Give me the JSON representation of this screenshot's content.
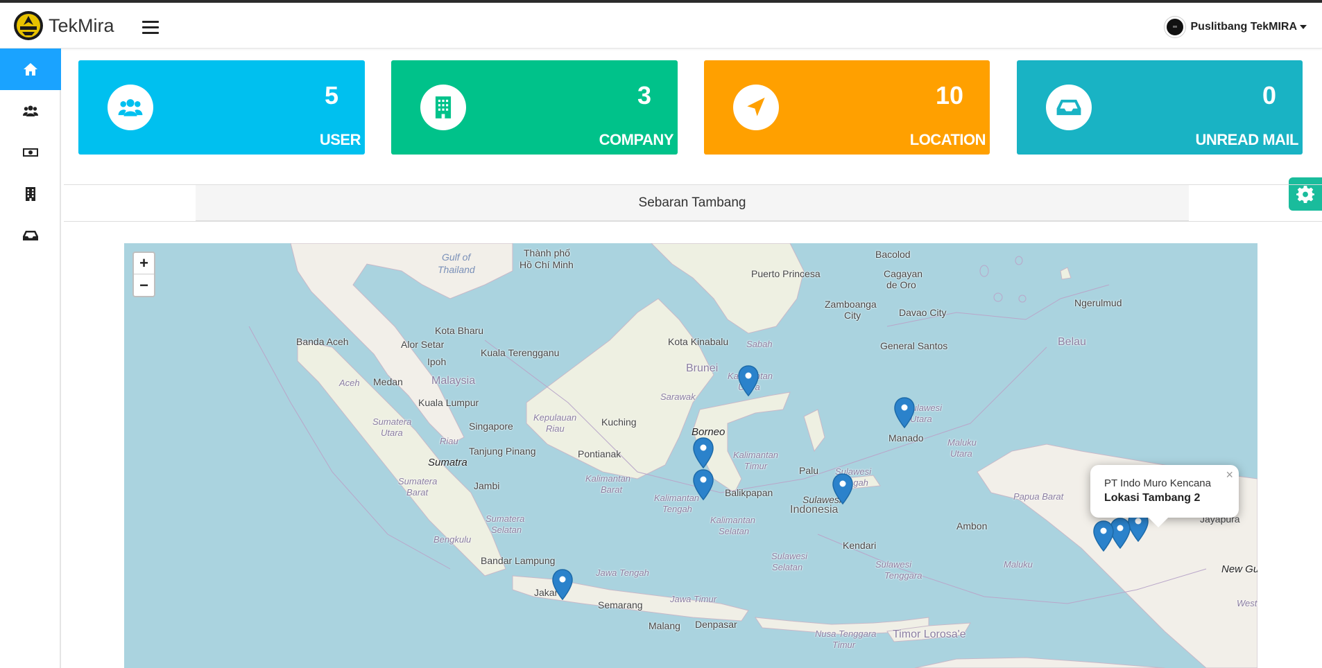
{
  "header": {
    "brand": "TekMira",
    "user_name": "Puslitbang TekMIRA"
  },
  "sidebar": {
    "items": [
      {
        "icon": "home-icon",
        "active": true
      },
      {
        "icon": "users-icon",
        "active": false
      },
      {
        "icon": "money-icon",
        "active": false
      },
      {
        "icon": "building-icon",
        "active": false
      },
      {
        "icon": "inbox-icon",
        "active": false
      }
    ]
  },
  "stats": [
    {
      "value": "5",
      "label": "USER",
      "color": "#00c0ef",
      "icon": "users-icon"
    },
    {
      "value": "3",
      "label": "COMPANY",
      "color": "#00c28a",
      "icon": "building-icon"
    },
    {
      "value": "10",
      "label": "LOCATION",
      "color": "#ffa000",
      "icon": "location-arrow-icon"
    },
    {
      "value": "0",
      "label": "UNREAD MAIL",
      "color": "#19b3c4",
      "icon": "inbox-icon"
    }
  ],
  "panel": {
    "title": "Sebaran Tambang"
  },
  "map": {
    "zoom_in": "+",
    "zoom_out": "−",
    "popup": {
      "company": "PT Indo Muro Kencana",
      "location": "Lokasi Tambang 2",
      "close": "×"
    },
    "labels": {
      "gulf": "Gulf of",
      "thailand": "Thailand",
      "hcm1": "Thành phố",
      "hcm2": "Hồ Chí Minh",
      "bacolod": "Bacolod",
      "puerto": "Puerto Princesa",
      "cagayan1": "Cagayan",
      "cagayan2": "de Oro",
      "zambo1": "Zamboanga",
      "zambo2": "City",
      "davao": "Davao City",
      "ngerulmud": "Ngerulmud",
      "kotabharu": "Kota Bharu",
      "bandaaceh": "Banda Aceh",
      "alorsetar": "Alor Setar",
      "kualat": "Kuala Terengganu",
      "kotakinabalu": "Kota Kinabalu",
      "sabah": "Sabah",
      "gensan": "General Santos",
      "belau": "Belau",
      "ipoh": "Ipoh",
      "brunei": "Brunei",
      "aceh": "Aceh",
      "medan": "Medan",
      "malaysia": "Malaysia",
      "kalut1": "Kalimantan",
      "kalut2": "Utara",
      "sarawak": "Sarawak",
      "kualalumpur": "Kuala Lumpur",
      "sulut1": "Sulawesi",
      "sulut2": "Utara",
      "sumut1": "Sumatera",
      "sumut2": "Utara",
      "singapore": "Singapore",
      "kepri1": "Kepulauan",
      "kepri2": "Riau",
      "kuching": "Kuching",
      "manado": "Manado",
      "riau": "Riau",
      "borneo": "Borneo",
      "malut1": "Maluku",
      "malut2": "Utara",
      "tanjung": "Tanjung Pinang",
      "pontianak": "Pontianak",
      "kaltim1": "Kalimantan",
      "kaltim2": "Timur",
      "sumatra": "Sumatra",
      "palu": "Palu",
      "sulteng1": "Sulawesi",
      "sulteng2": "Tengah",
      "sumbar1": "Sumatera",
      "sumbar2": "Barat",
      "jambi": "Jambi",
      "kalbar1": "Kalimantan",
      "kalbar2": "Barat",
      "balikpapan": "Balikpapan",
      "papuabarat": "Papua Barat",
      "kalteng1": "Kalimantan",
      "kalteng2": "Tengah",
      "sulawesi": "Sulawesi",
      "indonesia": "Indonesia",
      "sumsel1": "Sumatera",
      "sumsel2": "Selatan",
      "jayapura": "Jayapura",
      "kalsel1": "Kalimantan",
      "kalsel2": "Selatan",
      "ambon": "Ambon",
      "bengkulu": "Bengkulu",
      "kendari": "Kendari",
      "sulsel1": "Sulawesi",
      "sulsel2": "Selatan",
      "maluku": "Maluku",
      "sultra1": "Sulawesi",
      "sultra2": "Tenggara",
      "bandarlampung": "Bandar Lampung",
      "newgu": "New Gu",
      "jakarta": "Jakar",
      "jateng": "Jawa Tengah",
      "western": "Wester",
      "jatim": "Jawa Timur",
      "semarang": "Semarang",
      "malang": "Malang",
      "denpasar": "Denpasar",
      "ntt1": "Nusa Tenggara",
      "ntt2": "Timur",
      "timor": "Timor Lorosa'e"
    }
  }
}
